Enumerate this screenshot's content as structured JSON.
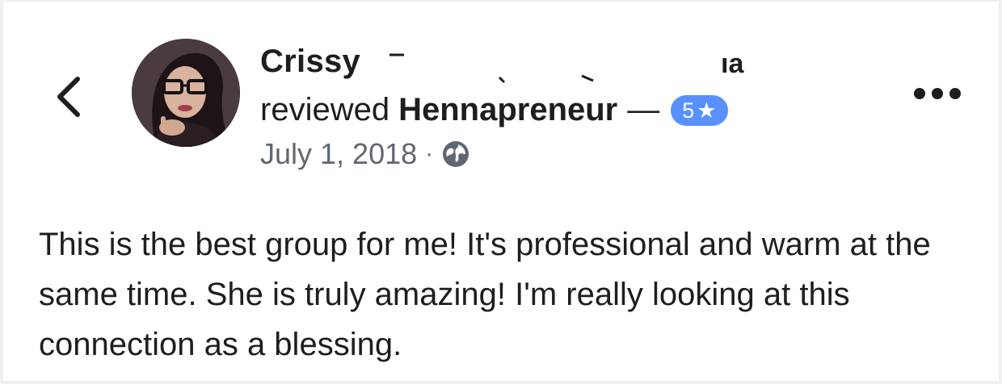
{
  "review": {
    "author_name": "Crissy",
    "author_name_trailing_glyphs": "ıa",
    "action_text": "reviewed",
    "page_name": "Hennapreneur",
    "dash": "—",
    "rating": "5",
    "rating_icon": "star-icon",
    "rating_star": "★",
    "date": "July 1, 2018",
    "separator": "·",
    "privacy_icon": "globe-icon",
    "body": "This is the best group for me! It's professional and warm at the same time. She is truly amazing! I'm really looking at this connection as a blessing."
  },
  "nav": {
    "back_icon": "chevron-left-icon",
    "more_icon": "more-options-icon"
  },
  "colors": {
    "badge": "#5890ff",
    "text_primary": "#1c1e21",
    "text_secondary": "#606770",
    "background": "#f0f0f0"
  }
}
